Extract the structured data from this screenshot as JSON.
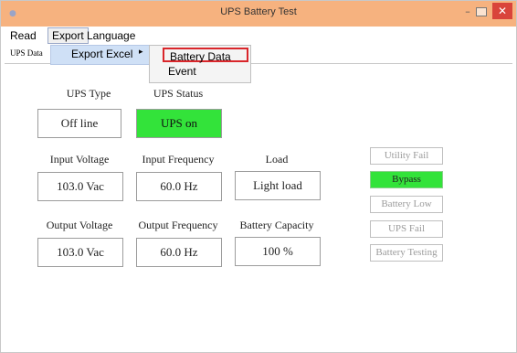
{
  "window": {
    "title": "UPS Battery Test",
    "minimize_glyph": "–",
    "close_glyph": "✕"
  },
  "menubar": {
    "items": [
      "Read",
      "Export",
      "Language"
    ]
  },
  "tab": {
    "label": "UPS Data"
  },
  "export_menu": {
    "item": "Export Excel",
    "arrow": "▸",
    "submenu": [
      "Battery Data",
      "Event"
    ]
  },
  "fields": {
    "ups_type": {
      "label": "UPS Type",
      "value": "Off line"
    },
    "ups_status": {
      "label": "UPS Status",
      "value": "UPS on"
    },
    "input_voltage": {
      "label": "Input Voltage",
      "value": "103.0 Vac"
    },
    "input_frequency": {
      "label": "Input Frequency",
      "value": "60.0 Hz"
    },
    "load": {
      "label": "Load",
      "value": "Light load"
    },
    "output_voltage": {
      "label": "Output Voltage",
      "value": "103.0 Vac"
    },
    "output_frequency": {
      "label": "Output Frequency",
      "value": "60.0 Hz"
    },
    "battery_capacity": {
      "label": "Battery Capacity",
      "value": "100 %"
    }
  },
  "status_indicators": [
    {
      "label": "Utility Fail",
      "active": false
    },
    {
      "label": "Bypass",
      "active": true
    },
    {
      "label": "Battery Low",
      "active": false
    },
    {
      "label": "UPS Fail",
      "active": false
    },
    {
      "label": "Battery Testing",
      "active": false
    }
  ],
  "colors": {
    "titlebar": "#f6b27f",
    "active_green": "#33e33a",
    "highlight_red": "#d9262b",
    "menu_highlight": "#cfe0f6"
  }
}
